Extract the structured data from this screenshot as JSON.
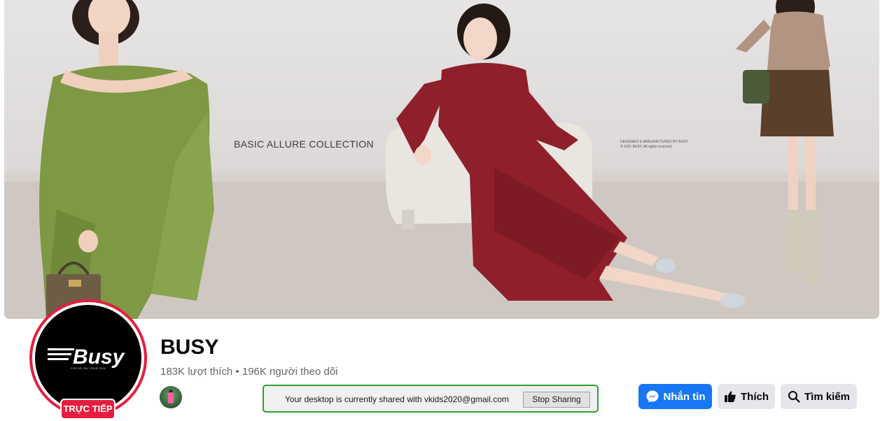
{
  "cover": {
    "headline": "BASIC ALLURE COLLECTION",
    "credit_line1": "DESIGNED & MANUFACTURED BY BUSY",
    "credit_line2": "© 2021 BUSY. All rights reserved."
  },
  "profile": {
    "logo_text": "Busy",
    "logo_tagline": "FOCUS ON YOUR 20%",
    "live_badge": "TRỰC TIẾP",
    "page_name": "BUSY",
    "stats": "183K lượt thích • 196K người theo dõi"
  },
  "screen_share": {
    "message": "Your desktop is currently shared with vkids2020@gmail.com",
    "stop_label": "Stop Sharing"
  },
  "actions": {
    "message_label": "Nhắn tin",
    "like_label": "Thích",
    "search_label": "Tìm kiếm"
  },
  "colors": {
    "primary_button": "#1877f2",
    "secondary_button": "#e4e6eb",
    "live_red": "#e41e3f",
    "share_border": "#2ea12e"
  }
}
